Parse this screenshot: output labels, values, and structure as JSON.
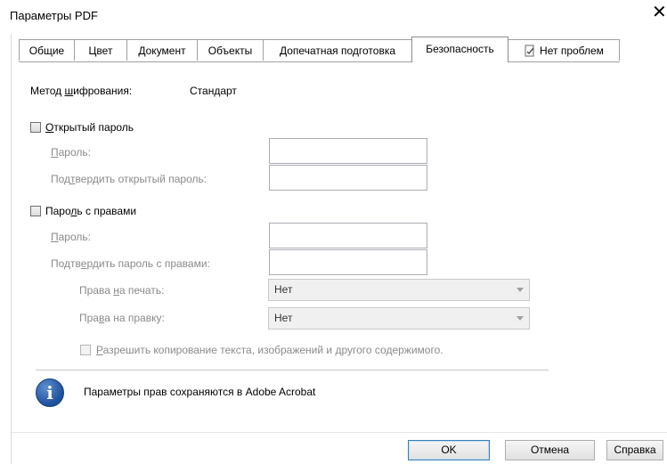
{
  "window": {
    "title": "Параметры PDF",
    "close_label": "✕"
  },
  "tabs": [
    {
      "label": "Общие"
    },
    {
      "label": "Цвет"
    },
    {
      "label": "Документ"
    },
    {
      "label": "Объекты"
    },
    {
      "label": "Допечатная подготовка"
    },
    {
      "label": "Безопасность",
      "active": true
    },
    {
      "label": "Нет проблем",
      "icon": "document-check-icon"
    }
  ],
  "encryption": {
    "label_pre": "Метод ",
    "label_u": "ш",
    "label_post": "ифрования:",
    "value": "Стандарт"
  },
  "open_password": {
    "checkbox_u": "О",
    "checkbox_post": "ткрытый пароль",
    "checked": false,
    "password_u": "П",
    "password_post": "ароль:",
    "confirm_pre": "Под",
    "confirm_u": "т",
    "confirm_post": "вердить открытый пароль:",
    "password_value": "",
    "confirm_value": ""
  },
  "permissions_password": {
    "checkbox_pre": "Паро",
    "checkbox_u": "л",
    "checkbox_post": "ь с правами",
    "checked": false,
    "password_u": "П",
    "password_post": "ароль:",
    "confirm_pre": "Подтв",
    "confirm_u": "е",
    "confirm_post": "рдить пароль с правами:",
    "password_value": "",
    "confirm_value": ""
  },
  "print_rights": {
    "label_pre": "Права ",
    "label_u": "н",
    "label_post": "а печать:",
    "value": "Нет"
  },
  "edit_rights": {
    "label_pre": "Пра",
    "label_u": "в",
    "label_post": "а на правку:",
    "value": "Нет"
  },
  "allow_copy": {
    "label_u": "Р",
    "label_post": "азрешить копирование текста, изображений и другого содержимого.",
    "checked": false
  },
  "info": {
    "icon": "info-icon",
    "text": "Параметры прав сохраняются в Adobe Acrobat"
  },
  "buttons": {
    "ok": "OK",
    "cancel": "Отмена",
    "help": "Справка"
  }
}
